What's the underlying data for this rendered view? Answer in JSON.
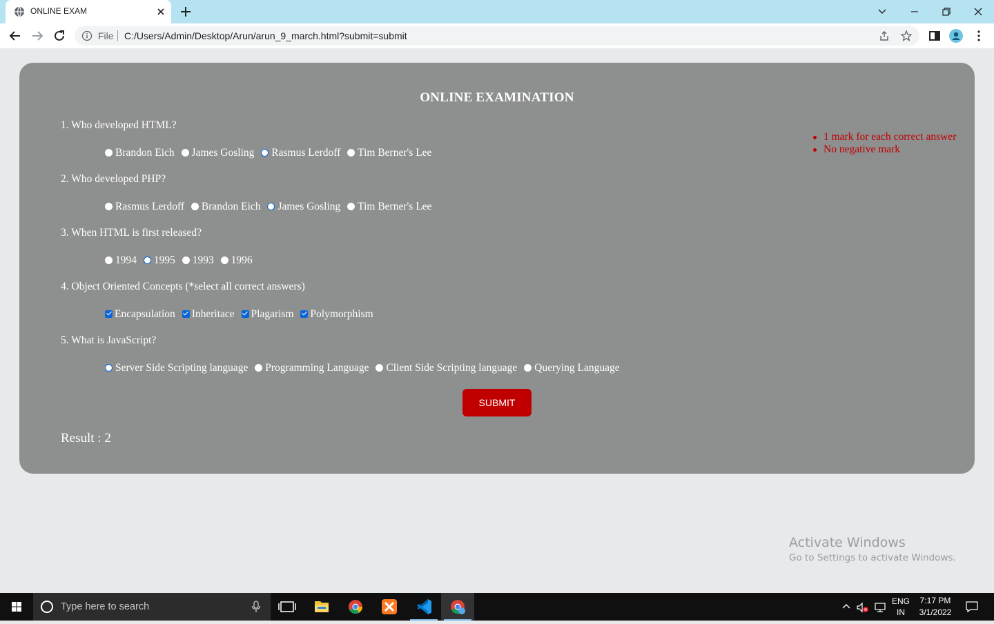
{
  "browser": {
    "tab_title": "ONLINE EXAM",
    "file_label": "File",
    "url": "C:/Users/Admin/Desktop/Arun/arun_9_march.html?submit=submit"
  },
  "exam": {
    "title": "ONLINE EXAMINATION",
    "instructions": [
      "1 mark for each correct answer",
      "No negative mark"
    ],
    "questions": [
      {
        "label": "1. Who developed HTML?",
        "type": "radio",
        "options": [
          "Brandon Eich",
          "James Gosling",
          "Rasmus Lerdoff",
          "Tim Berner's Lee"
        ],
        "selected": "Rasmus Lerdoff"
      },
      {
        "label": "2. Who developed PHP?",
        "type": "radio",
        "options": [
          "Rasmus Lerdoff",
          "Brandon Eich",
          "James Gosling",
          "Tim Berner's Lee"
        ],
        "selected": "James Gosling"
      },
      {
        "label": "3. When HTML is first released?",
        "type": "radio",
        "options": [
          "1994",
          "1995",
          "1993",
          "1996"
        ],
        "selected": "1995"
      },
      {
        "label": "4. Object Oriented Concepts (*select all correct answers)",
        "type": "checkbox",
        "options": [
          "Encapsulation",
          "Inheritace",
          "Plagarism",
          "Polymorphism"
        ],
        "checked": [
          "Encapsulation",
          "Inheritace",
          "Plagarism",
          "Polymorphism"
        ]
      },
      {
        "label": "5. What is JavaScript?",
        "type": "radio",
        "options": [
          "Server Side Scripting language",
          "Programming Language",
          "Client Side Scripting language",
          "Querying Language"
        ],
        "selected": "Server Side Scripting language"
      }
    ],
    "submit_label": "SUBMIT",
    "result_text": "Result : 2"
  },
  "watermark": {
    "title": "Activate Windows",
    "subtitle": "Go to Settings to activate Windows."
  },
  "taskbar": {
    "search_placeholder": "Type here to search",
    "lang_top": "ENG",
    "lang_bottom": "IN",
    "time": "7:17 PM",
    "date": "3/1/2022"
  },
  "colors": {
    "card_bg": "#8e8f8f",
    "accent_red": "#c00000",
    "tab_strip": "#b5e3f2",
    "control_blue": "#0a66d8"
  }
}
